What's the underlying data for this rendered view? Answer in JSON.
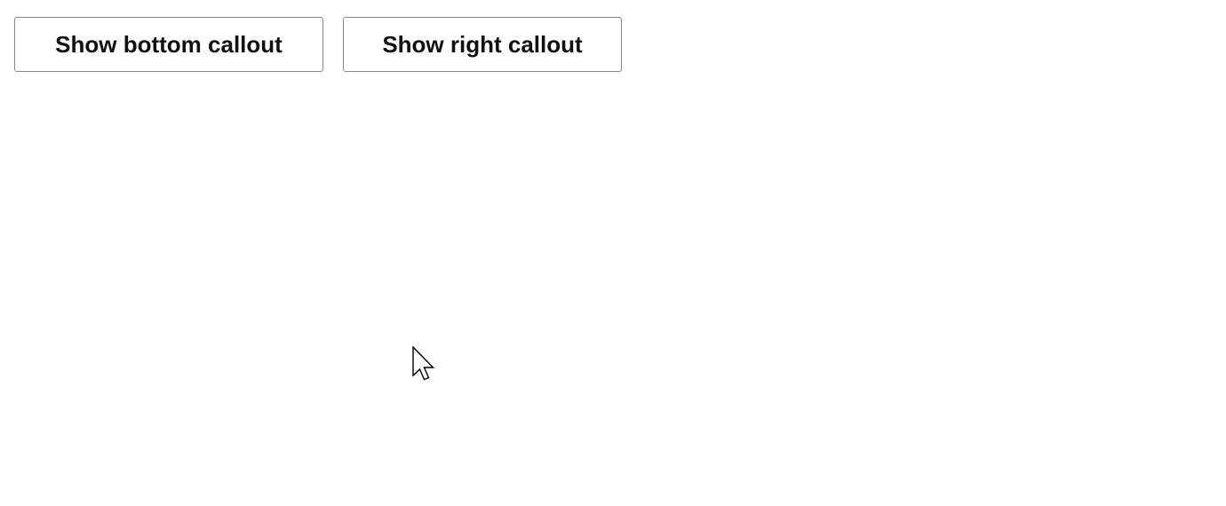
{
  "buttons": {
    "bottom_callout_label": "Show bottom callout",
    "right_callout_label": "Show right callout"
  },
  "cursor": {
    "icon": "arrow-pointer-icon"
  }
}
